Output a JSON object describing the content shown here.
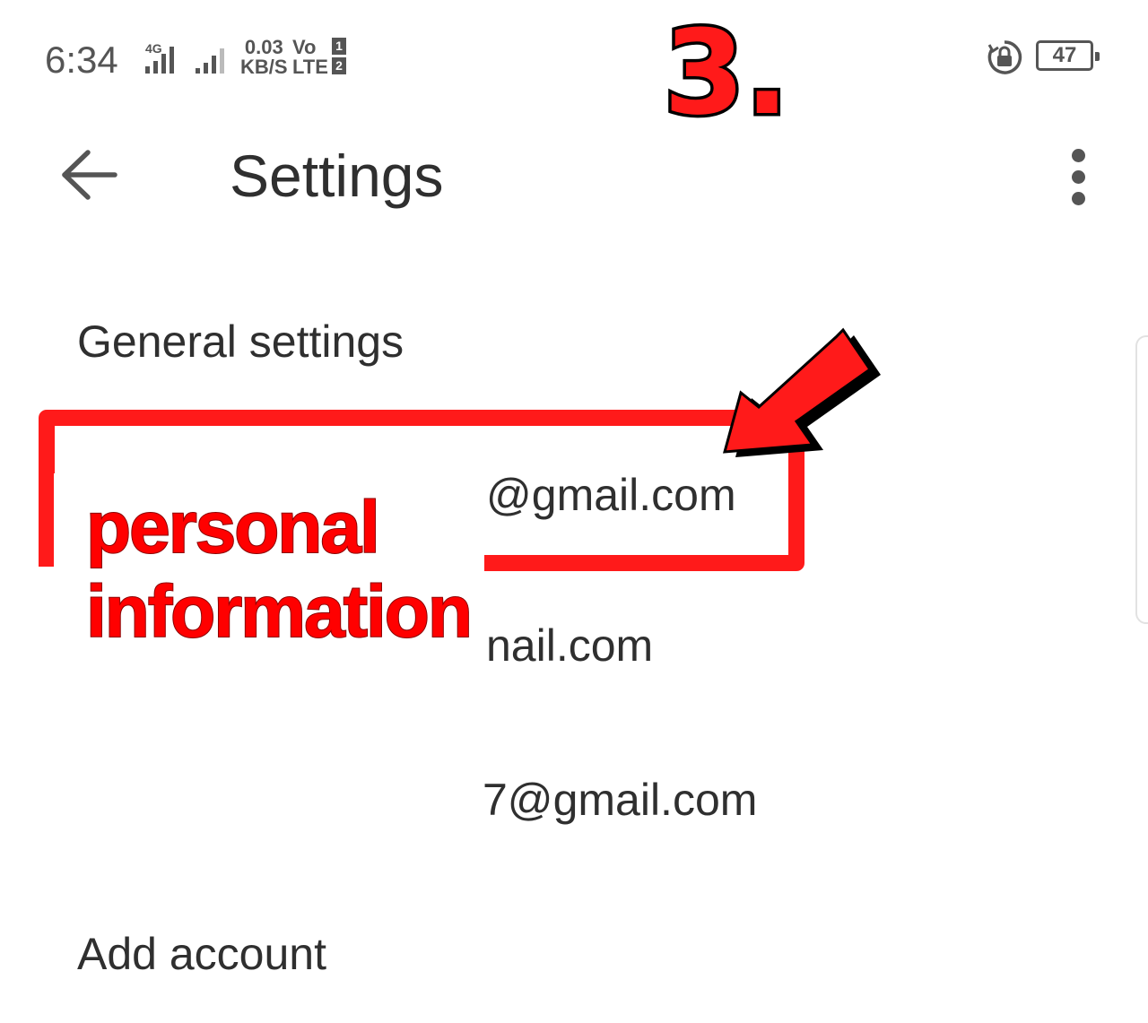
{
  "status_bar": {
    "time": "6:34",
    "network_type": "4G",
    "speed_value": "0.03",
    "speed_unit": "KB/S",
    "volte_top": "Vo",
    "volte_bottom": "LTE",
    "sim_1": "1",
    "sim_2": "2",
    "battery_level": "47"
  },
  "annotation": {
    "step_label": "3.",
    "privacy_line1": "personal",
    "privacy_line2": "information",
    "accent_color": "#ff1a1a"
  },
  "app_bar": {
    "title": "Settings",
    "back_icon": "arrow-left-icon",
    "menu_icon": "more-vert-icon"
  },
  "list": {
    "general_settings": "General settings",
    "accounts": [
      "@gmail.com",
      "nail.com",
      "7@gmail.com"
    ],
    "add_account": "Add account"
  }
}
